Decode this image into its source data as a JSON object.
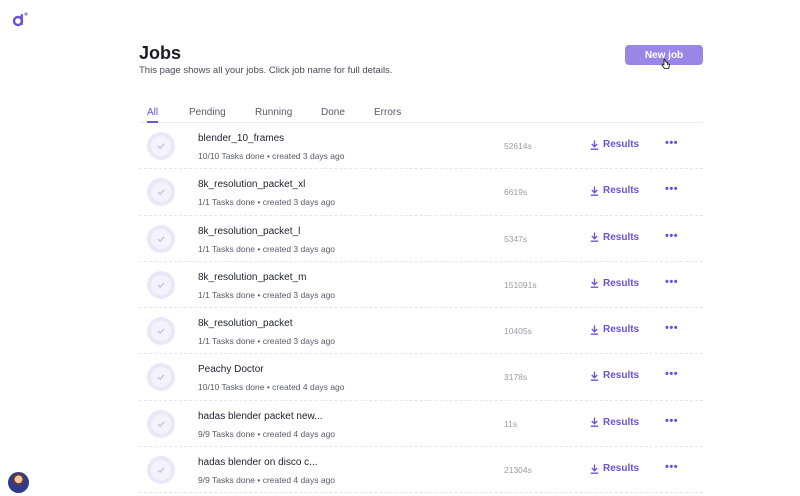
{
  "brand": {
    "logo_icon": "app-logo-icon",
    "accent": "#6b52d6"
  },
  "header": {
    "title": "Jobs",
    "subtitle": "This page shows all your jobs. Click job name for full details.",
    "new_job_label": "New job"
  },
  "tabs": [
    {
      "label": "All",
      "active": true
    },
    {
      "label": "Pending"
    },
    {
      "label": "Running"
    },
    {
      "label": "Done"
    },
    {
      "label": "Errors"
    }
  ],
  "jobs": [
    {
      "name": "blender_10_frames",
      "meta": "10/10 Tasks done • created 3 days ago",
      "duration": "52614s",
      "results_label": "Results",
      "more_label": "•••"
    },
    {
      "name": "8k_resolution_packet_xl",
      "meta": "1/1 Tasks done • created 3 days ago",
      "duration": "6619s",
      "results_label": "Results",
      "more_label": "•••"
    },
    {
      "name": "8k_resolution_packet_l",
      "meta": "1/1 Tasks done • created 3 days ago",
      "duration": "5347s",
      "results_label": "Results",
      "more_label": "•••"
    },
    {
      "name": "8k_resolution_packet_m",
      "meta": "1/1 Tasks done • created 3 days ago",
      "duration": "151091s",
      "results_label": "Results",
      "more_label": "•••"
    },
    {
      "name": "8k_resolution_packet",
      "meta": "1/1 Tasks done • created 3 days ago",
      "duration": "10405s",
      "results_label": "Results",
      "more_label": "•••"
    },
    {
      "name": "Peachy Doctor",
      "meta": "10/10 Tasks done • created 4 days ago",
      "duration": "3178s",
      "results_label": "Results",
      "more_label": "•••"
    },
    {
      "name": "hadas blender packet new...",
      "meta": "9/9 Tasks done • created 4 days ago",
      "duration": "11s",
      "results_label": "Results",
      "more_label": "•••"
    },
    {
      "name": "hadas blender on disco c...",
      "meta": "9/9 Tasks done • created 4 days ago",
      "duration": "21304s",
      "results_label": "Results",
      "more_label": "•••"
    }
  ]
}
